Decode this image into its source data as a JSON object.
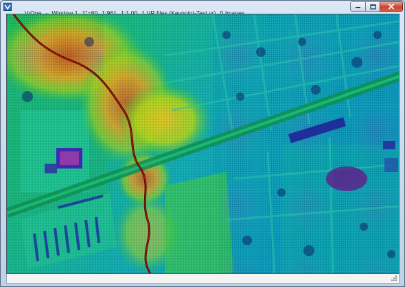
{
  "window": {
    "app_name": "VrOne",
    "window_label": "Window 1",
    "scale_inch": "1\"=80",
    "scale_ratio": "1:961",
    "zoom": "1:1.00",
    "files": "1 VR files (Keypoint-Test.vr)",
    "images": "0 Images"
  },
  "controls": {
    "minimize": "minimize-icon",
    "maximize": "maximize-icon",
    "close": "close-icon"
  },
  "viewport": {
    "content": "lidar point cloud colored by elevation",
    "palette": [
      "#1e2f8c",
      "#128fb5",
      "#16c2a0",
      "#28c23c",
      "#a2d51a",
      "#f0a81a",
      "#d63a10",
      "#8a0a0a"
    ]
  }
}
